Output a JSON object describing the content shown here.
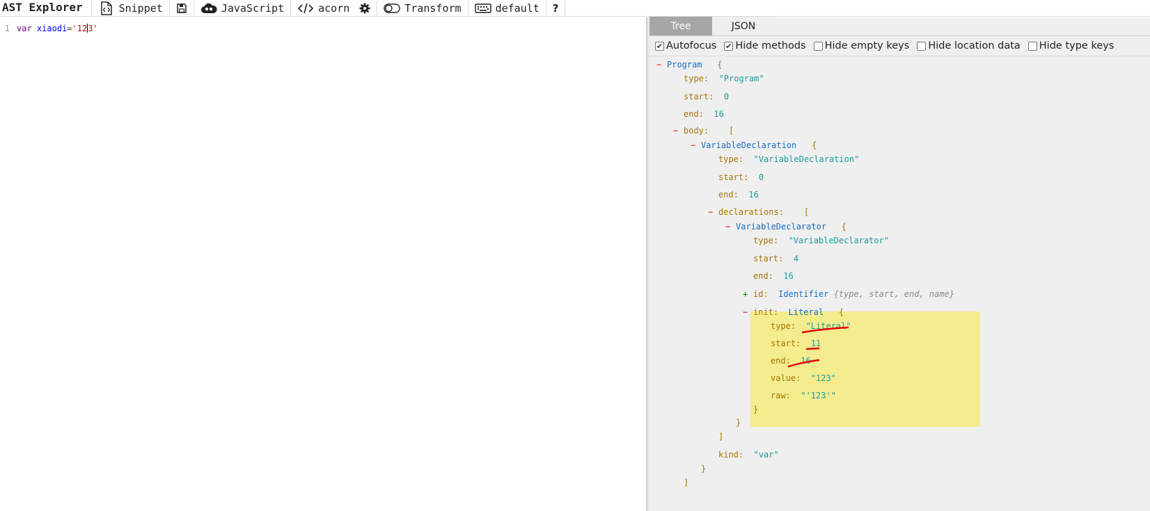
{
  "toolbar": {
    "title": "AST Explorer",
    "snippet_label": "Snippet",
    "language_label": "JavaScript",
    "parser_label": "acorn",
    "transform_label": "Transform",
    "keymap_label": "default",
    "help_label": "?"
  },
  "editor": {
    "line_number": "1",
    "code_keyword": "var",
    "code_identifier": "xiaodi",
    "code_operator": "=",
    "code_string_before_cursor": "'12",
    "code_string_after_cursor": "3'"
  },
  "tabs": {
    "tree": "Tree",
    "json": "JSON"
  },
  "options": {
    "autofocus": {
      "label": "Autofocus",
      "checked": true
    },
    "hide_methods": {
      "label": "Hide methods",
      "checked": true
    },
    "hide_empty_keys": {
      "label": "Hide empty keys",
      "checked": false
    },
    "hide_location_data": {
      "label": "Hide location data",
      "checked": false
    },
    "hide_type_keys": {
      "label": "Hide type keys",
      "checked": false
    }
  },
  "tree": {
    "program": {
      "toggle": "−",
      "type_name": "Program",
      "open_brace": "{"
    },
    "program_type": {
      "key": "type:",
      "value": "\"Program\""
    },
    "program_start": {
      "key": "start:",
      "value": "0"
    },
    "program_end": {
      "key": "end:",
      "value": "16"
    },
    "body": {
      "toggle": "−",
      "key": "body:",
      "open_bracket": "["
    },
    "var_decl": {
      "toggle": "−",
      "type_name": "VariableDeclaration",
      "open_brace": "{"
    },
    "var_decl_type": {
      "key": "type:",
      "value": "\"VariableDeclaration\""
    },
    "var_decl_start": {
      "key": "start:",
      "value": "0"
    },
    "var_decl_end": {
      "key": "end:",
      "value": "16"
    },
    "declarations": {
      "toggle": "−",
      "key": "declarations:",
      "open_bracket": "["
    },
    "declarator": {
      "toggle": "−",
      "type_name": "VariableDeclarator",
      "open_brace": "{"
    },
    "declarator_type": {
      "key": "type:",
      "value": "\"VariableDeclarator\""
    },
    "declarator_start": {
      "key": "start:",
      "value": "4"
    },
    "declarator_end": {
      "key": "end:",
      "value": "16"
    },
    "id": {
      "toggle": "+",
      "key": "id:",
      "type_name": "Identifier",
      "summary": "{type, start, end, name}"
    },
    "init": {
      "toggle": "−",
      "key": "init:",
      "type_name": "Literal",
      "open_brace": "{"
    },
    "init_type": {
      "key": "type:",
      "value": "\"Literal\""
    },
    "init_start": {
      "key": "start:",
      "value": "11"
    },
    "init_end": {
      "key": "end:",
      "value": "16"
    },
    "init_value": {
      "key": "value:",
      "value": "\"123\""
    },
    "init_raw": {
      "key": "raw:",
      "value": "\"'123'\""
    },
    "init_close": "}",
    "declarator_close": "}",
    "declarations_close": "]",
    "kind": {
      "key": "kind:",
      "value": "\"var\""
    },
    "var_decl_close": "}",
    "body_close": "]"
  },
  "colors": {
    "highlight": "#f4ec8e",
    "annotation_red": "#e8000b",
    "active_tab": "#a6a6a6"
  }
}
